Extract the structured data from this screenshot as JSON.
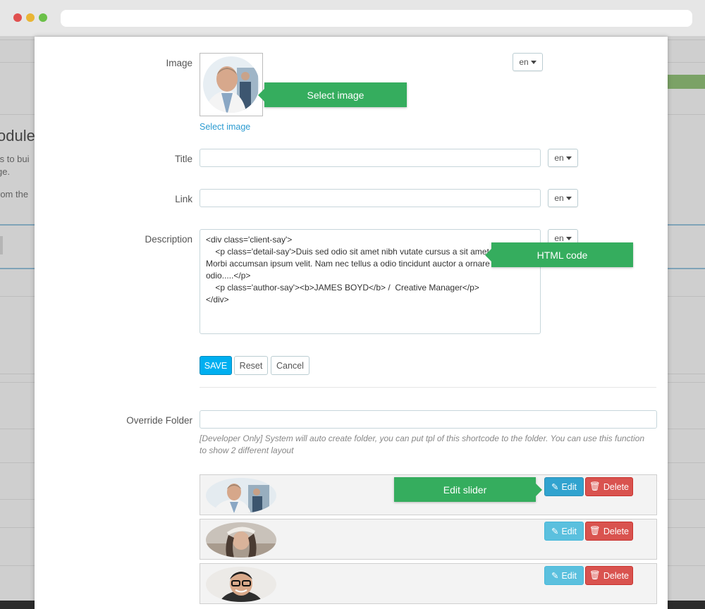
{
  "background": {
    "heading": "odules",
    "text1": "ts to bui",
    "text2": "ge.",
    "text3": "rom the"
  },
  "form": {
    "image_label": "Image",
    "select_image_link": "Select image",
    "title_label": "Title",
    "title_value": "",
    "link_label": "Link",
    "link_value": "",
    "description_label": "Description",
    "description_lines": [
      "<div class='client-say'>",
      "    <p class='detail-say'>Duis sed odio sit amet nibh vutate cursus a sit amet mauris.",
      "Morbi accumsan ipsum velit. Nam nec tellus a odio tincidunt auctor a ornare",
      "odio.....</p>",
      "    <p class='author-say'><b>JAMES BOYD</b> /  Creative Manager</p>",
      "</div>"
    ],
    "lang": "en",
    "save_label": "SAVE",
    "reset_label": "Reset",
    "cancel_label": "Cancel",
    "override_label": "Override Folder",
    "override_value": "",
    "override_help": "[Developer Only] System will auto create folder, you can put tpl of this shortcode to the folder. You can use this function to show 2 different layout"
  },
  "slides": [
    {
      "edit_label": "Edit",
      "delete_label": "Delete"
    },
    {
      "edit_label": "Edit",
      "delete_label": "Delete"
    },
    {
      "edit_label": "Edit",
      "delete_label": "Delete"
    }
  ],
  "callouts": {
    "select_image": "Select image",
    "html_code": "HTML code",
    "edit_slider": "Edit slider"
  },
  "colors": {
    "callout": "#35ad5e",
    "save": "#00aff0",
    "edit": "#5bc0de",
    "delete": "#d9534f",
    "link": "#2b9bd1"
  }
}
